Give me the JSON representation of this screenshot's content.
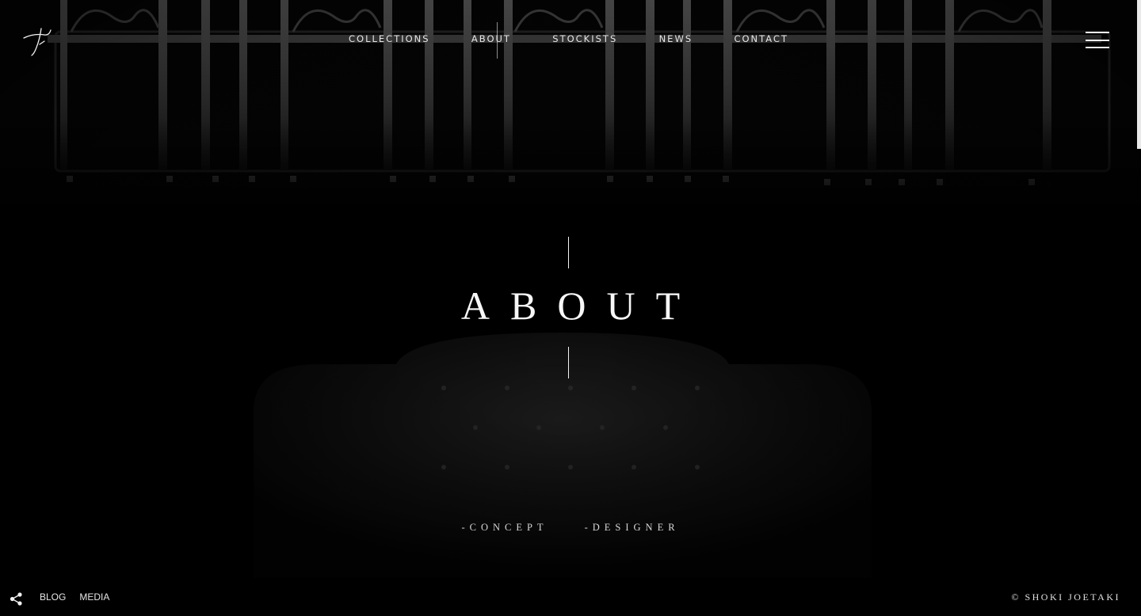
{
  "brand": {
    "logo_icon": "signature-logo-icon"
  },
  "nav": {
    "items": [
      {
        "label": "COLLECTIONS"
      },
      {
        "label": "ABOUT"
      },
      {
        "label": "STOCKISTS"
      },
      {
        "label": "NEWS"
      },
      {
        "label": "CONTACT"
      }
    ],
    "active": "ABOUT",
    "menu_icon": "hamburger-menu-icon"
  },
  "hero": {
    "title": "ABOUT"
  },
  "subnav": {
    "items": [
      {
        "label": "-CONCEPT"
      },
      {
        "label": "-DESIGNER"
      }
    ]
  },
  "footer": {
    "share_icon": "share-icon",
    "links": [
      {
        "label": "BLOG"
      },
      {
        "label": "MEDIA"
      }
    ],
    "copyright": "© SHOKI JOETAKI"
  },
  "colors": {
    "background": "#000000",
    "text": "#f7f7f7",
    "muted_text": "#d8d8d8"
  }
}
